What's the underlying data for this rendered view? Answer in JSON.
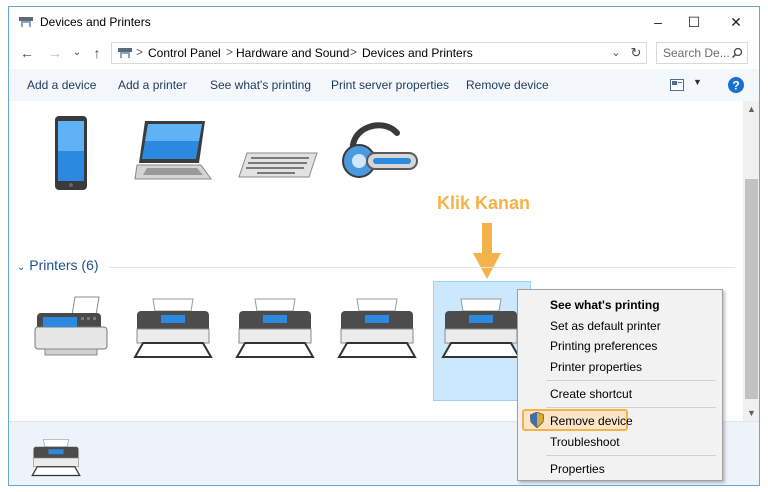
{
  "window": {
    "title": "Devices and Printers",
    "controls": {
      "minimize": "–",
      "maximize": "☐",
      "close": "✕"
    }
  },
  "address": {
    "breadcrumbs": [
      "Control Panel",
      "Hardware and Sound",
      "Devices and Printers"
    ],
    "separator": ">",
    "search_placeholder": "Search De..."
  },
  "toolbar": {
    "items": [
      "Add a device",
      "Add a printer",
      "See what's printing",
      "Print server properties",
      "Remove device"
    ]
  },
  "annotation": {
    "text": "Klik Kanan",
    "color": "#f6b24a"
  },
  "printers_group": {
    "label": "Printers (6)"
  },
  "context_menu": {
    "items": [
      "See what's printing",
      "Set as default printer",
      "Printing preferences",
      "Printer properties",
      "Create shortcut",
      "Remove device",
      "Troubleshoot",
      "Properties"
    ]
  },
  "colors": {
    "accent": "#1e4e8c",
    "highlight": "#f6b24a",
    "selection": "#cce8ff"
  }
}
